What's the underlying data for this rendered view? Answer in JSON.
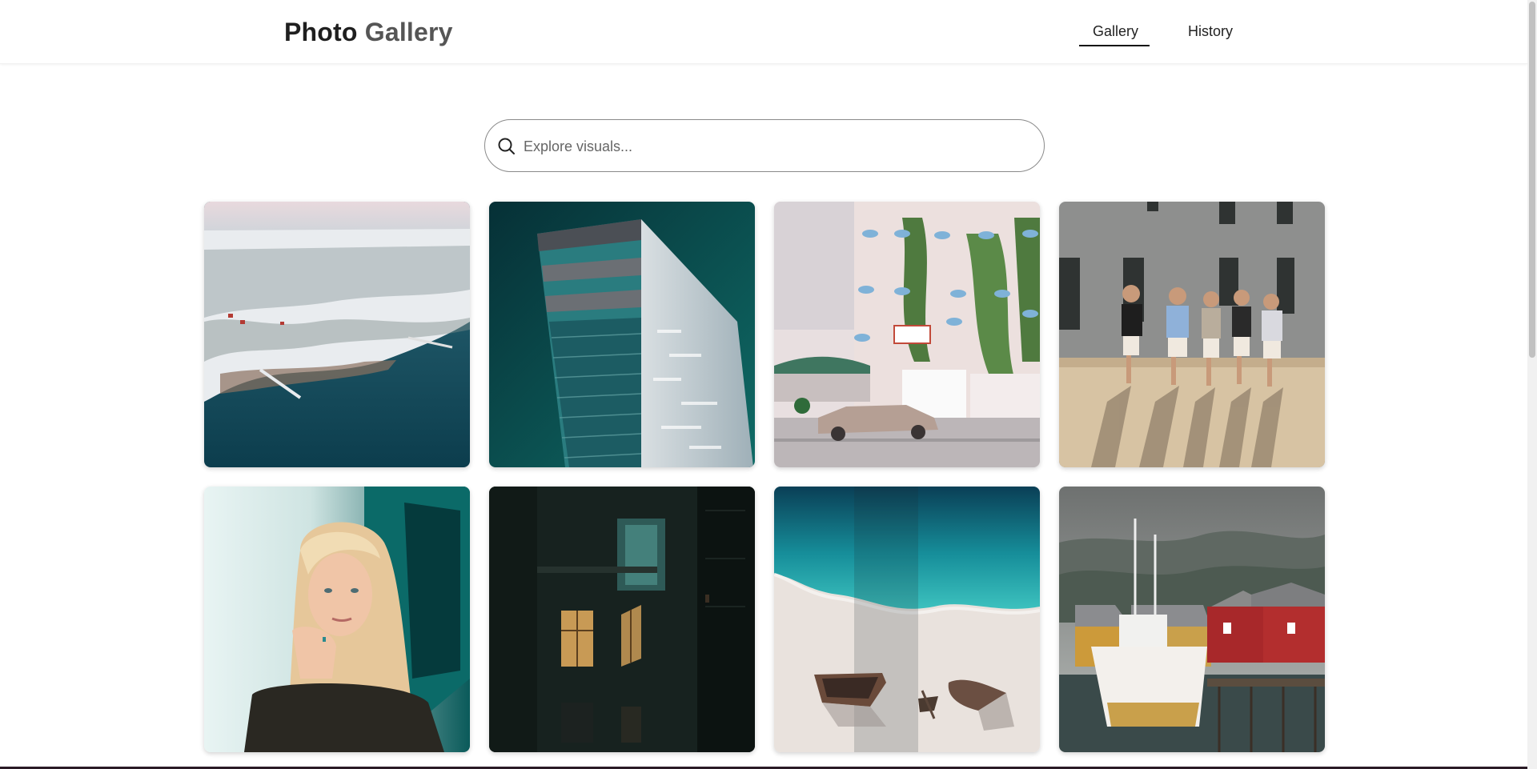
{
  "header": {
    "brand_word1": "Photo",
    "brand_word2": "Gallery",
    "tabs": [
      {
        "label": "Gallery",
        "active": true
      },
      {
        "label": "History",
        "active": false
      }
    ]
  },
  "search": {
    "placeholder": "Explore visuals...",
    "value": "",
    "icon": "search-icon"
  },
  "gallery": {
    "items": [
      {
        "subject": "snowy coastline aerial"
      },
      {
        "subject": "teal building tower"
      },
      {
        "subject": "ivy hotel street with vintage car"
      },
      {
        "subject": "group sitting on ledge"
      },
      {
        "subject": "blonde woman portrait"
      },
      {
        "subject": "dark building with lit windows"
      },
      {
        "subject": "shipwrecks on white beach"
      },
      {
        "subject": "fishing boat at red harbor"
      }
    ]
  },
  "colors": {
    "accent": "#111111",
    "placeholder": "#666666",
    "border": "#8a8a8a"
  }
}
